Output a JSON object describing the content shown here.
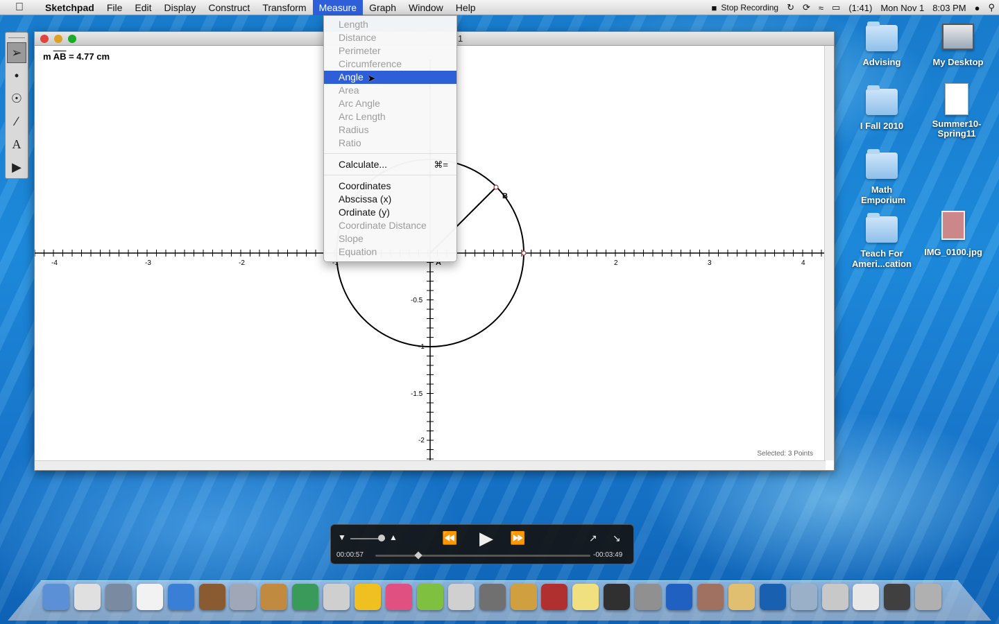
{
  "menubar": {
    "app_name": "Sketchpad",
    "items": [
      "File",
      "Edit",
      "Display",
      "Construct",
      "Transform",
      "Measure",
      "Graph",
      "Window",
      "Help"
    ],
    "active_item": "Measure",
    "status": {
      "stop_recording": "Stop Recording",
      "battery": "(1:41)",
      "date": "Mon Nov 1",
      "time": "8:03 PM"
    }
  },
  "measure_menu": {
    "group1": [
      {
        "label": "Length",
        "enabled": false
      },
      {
        "label": "Distance",
        "enabled": false
      },
      {
        "label": "Perimeter",
        "enabled": false
      },
      {
        "label": "Circumference",
        "enabled": false
      },
      {
        "label": "Angle",
        "enabled": true,
        "highlighted": true
      },
      {
        "label": "Area",
        "enabled": false
      },
      {
        "label": "Arc Angle",
        "enabled": false
      },
      {
        "label": "Arc Length",
        "enabled": false
      },
      {
        "label": "Radius",
        "enabled": false
      },
      {
        "label": "Ratio",
        "enabled": false
      }
    ],
    "calculate": {
      "label": "Calculate...",
      "shortcut": "⌘="
    },
    "group3": [
      {
        "label": "Coordinates",
        "enabled": true
      },
      {
        "label": "Abscissa (x)",
        "enabled": true
      },
      {
        "label": "Ordinate (y)",
        "enabled": true
      },
      {
        "label": "Coordinate Distance",
        "enabled": false
      },
      {
        "label": "Slope",
        "enabled": false
      },
      {
        "label": "Equation",
        "enabled": false
      }
    ]
  },
  "sketch_window": {
    "title": "1",
    "measurement": {
      "prefix": "m ",
      "segment": "AB",
      "suffix": " = 4.77 cm"
    },
    "status": "Selected: 3 Points",
    "x_axis_labels": [
      "-4",
      "-3",
      "-2",
      "-1",
      "2",
      "3",
      "4"
    ],
    "y_axis_labels": [
      "-0.5",
      "-1",
      "-1.5",
      "-2"
    ],
    "point_labels": [
      "A",
      "B"
    ]
  },
  "toolbox": [
    "selection-arrow",
    "point",
    "compass",
    "straightedge",
    "text",
    "custom-tool"
  ],
  "desktop_icons": [
    {
      "label": "Advising",
      "kind": "folder"
    },
    {
      "label": "My Desktop",
      "kind": "screen"
    },
    {
      "label": "I Fall 2010",
      "kind": "folder"
    },
    {
      "label": "Summer10-Spring11",
      "kind": "doc"
    },
    {
      "label": "Math Emporium",
      "kind": "folder"
    },
    {
      "label": "Teach For Ameri...cation",
      "kind": "folder"
    },
    {
      "label": "IMG_0100.jpg",
      "kind": "photo"
    }
  ],
  "player": {
    "elapsed": "00:00:57",
    "remaining": "-00:03:49"
  },
  "dock": [
    "finder",
    "chrome",
    "mail",
    "ical",
    "itunes",
    "iphoto",
    "iweb",
    "keynote",
    "numbers",
    "calculator",
    "grapher",
    "color",
    "garageband",
    "cyberduck",
    "latexit",
    "word",
    "dictionary",
    "stickies",
    "activity-monitor",
    "system-preferences",
    "safari",
    "photo-booth",
    "address-book",
    "quicktime",
    "applications",
    "home",
    "pdf",
    "screen-recorder",
    "trash"
  ]
}
